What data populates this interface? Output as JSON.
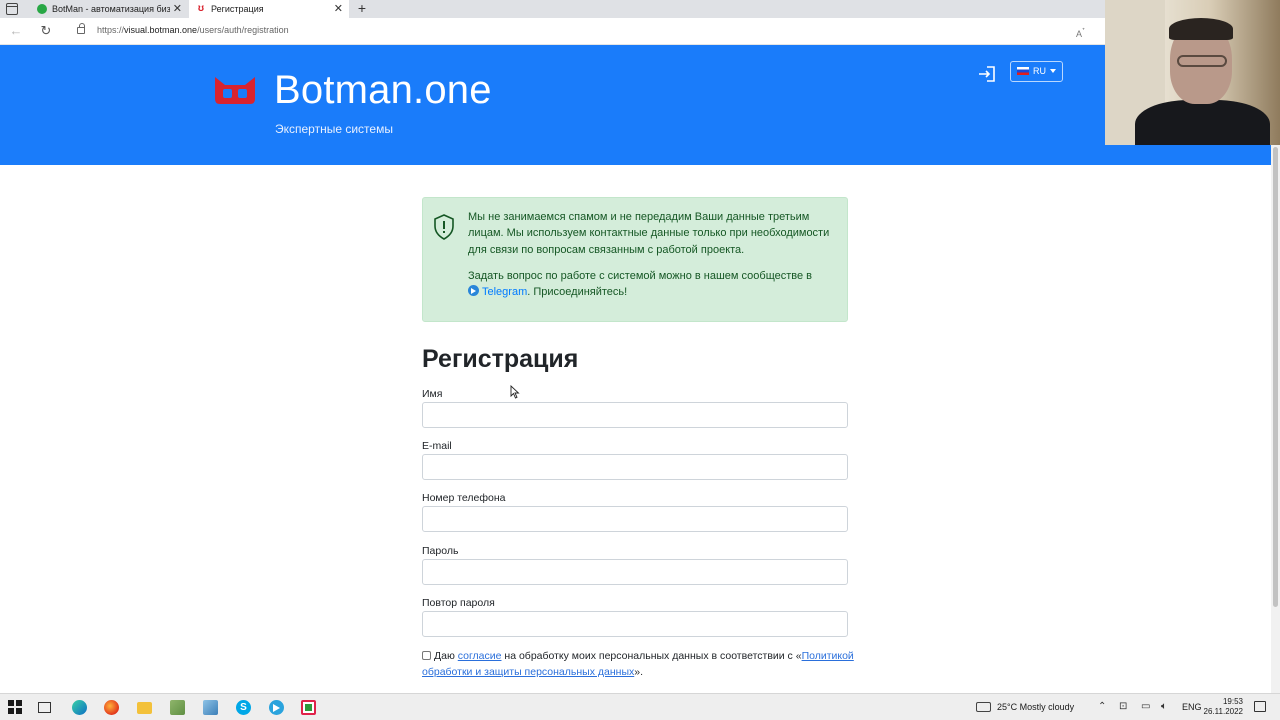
{
  "browser": {
    "tabs": [
      {
        "title": "BotMan - автоматизация бизнес",
        "active": false
      },
      {
        "title": "Регистрация",
        "active": true
      }
    ],
    "new_tab_symbol": "+",
    "url_prefix": "https://",
    "url_host": "visual.botman.one",
    "url_path": "/users/auth/registration"
  },
  "header": {
    "site_name": "Botman.one",
    "tagline": "Экспертные системы",
    "language": "RU",
    "brand_color": "#1a7cfa",
    "logo_color": "#d9232e"
  },
  "notice": {
    "paragraph1": "Мы не занимаемся спамом и не передадим Ваши данные третьим лицам. Мы используем контактные данные только при необходимости для связи по вопросам связанным с работой проекта.",
    "paragraph2_before": "Задать вопрос по работе с системой можно в нашем сообществе в",
    "telegram_link": "Telegram",
    "paragraph2_after": ". Присоединяйтесь!"
  },
  "form": {
    "title": "Регистрация",
    "fields": [
      {
        "label": "Имя",
        "value": ""
      },
      {
        "label": "E-mail",
        "value": ""
      },
      {
        "label": "Номер телефона",
        "value": ""
      },
      {
        "label": "Пароль",
        "value": ""
      },
      {
        "label": "Повтор пароля",
        "value": ""
      }
    ],
    "consent": {
      "checked": false,
      "text_before": "Даю",
      "link1": "согласие",
      "text_middle": "на обработку моих персональных данных в соответствии с «",
      "link2": "Политикой обработки и защиты персональных данных",
      "text_after": "»."
    }
  },
  "taskbar": {
    "weather": "25°C  Mostly cloudy",
    "language": "ENG",
    "time": "19:53",
    "date": "26.11.2022"
  }
}
